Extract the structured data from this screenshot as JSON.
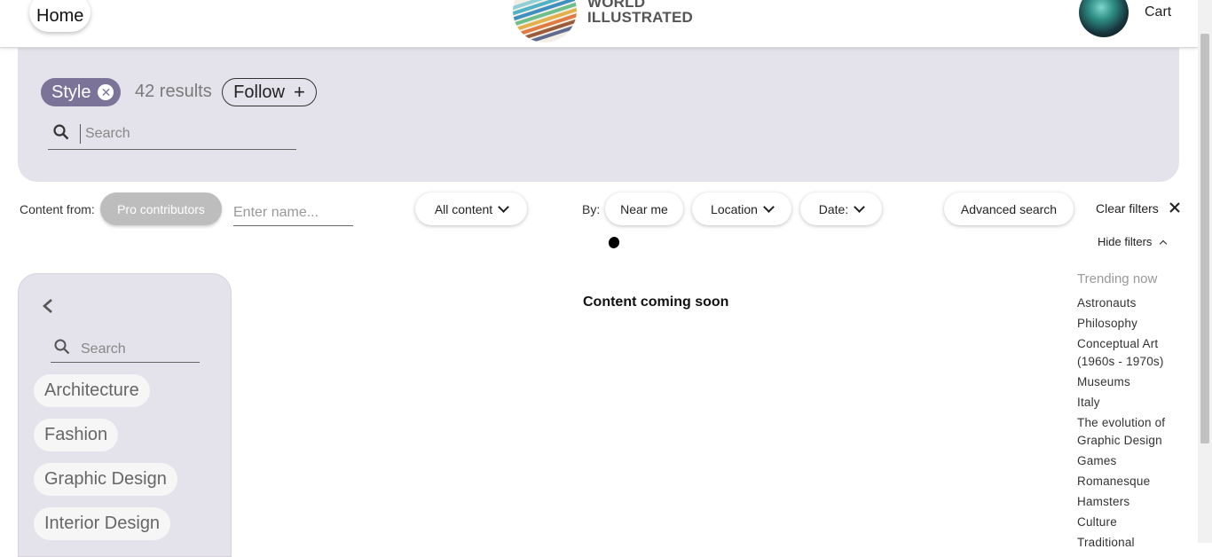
{
  "header": {
    "home_label": "Home",
    "logo_line1": "WORLD",
    "logo_line2": "ILLUSTRATED",
    "cart_label": "Cart"
  },
  "topic": {
    "chip_label": "Style",
    "chip_remove_icon": "close-circle-icon",
    "results": "42 results",
    "follow_label": "Follow",
    "follow_icon": "plus-icon",
    "search_placeholder": "Search",
    "panel_color": "#e4e2ea",
    "chip_color": "#7c7398"
  },
  "filters": {
    "content_from_label": "Content from:",
    "pro_contributors_label": "Pro contributors",
    "name_placeholder": "Enter name...",
    "all_content_label": "All content",
    "by_label": "By:",
    "near_me_label": "Near me",
    "location_label": "Location",
    "date_label": "Date:",
    "advanced_search_label": "Advanced search",
    "clear_filters_label": "Clear filters",
    "hide_filters_label": "Hide filters"
  },
  "sidebar": {
    "search_placeholder": "Search",
    "categories": [
      "Architecture",
      "Fashion",
      "Graphic Design",
      "Interior Design"
    ]
  },
  "main": {
    "message": "Content coming soon"
  },
  "trending": {
    "title": "Trending now",
    "items": [
      "Astronauts",
      "Philosophy",
      "Conceptual Art (1960s - 1970s)",
      "Museums",
      "Italy",
      "The evolution of Graphic Design",
      "Games",
      "Romanesque",
      "Hamsters",
      "Culture",
      "Traditional"
    ]
  }
}
